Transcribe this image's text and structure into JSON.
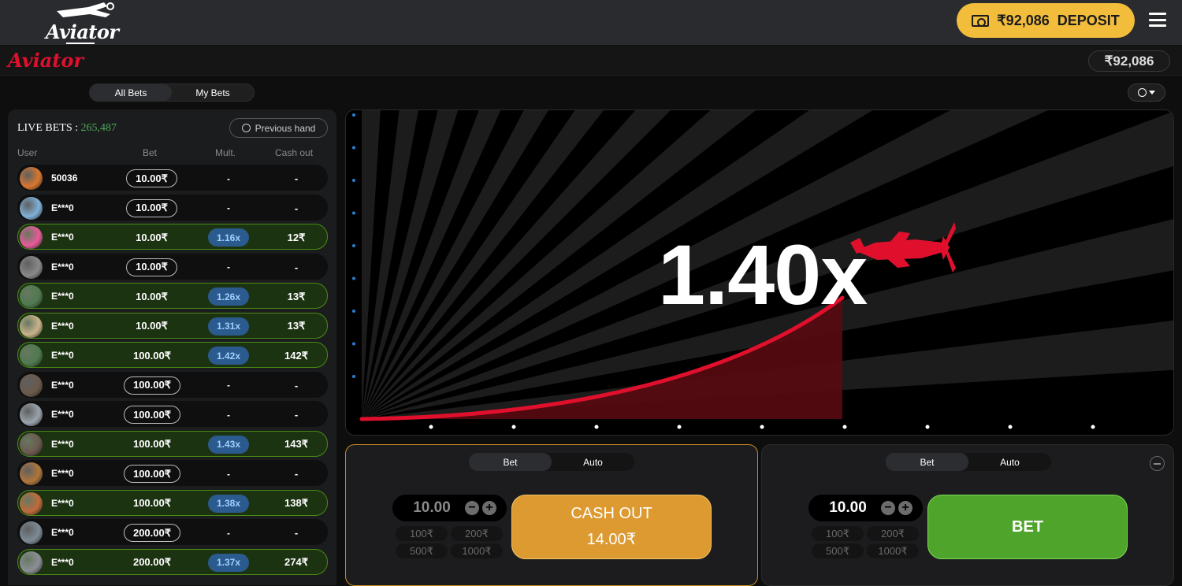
{
  "header": {
    "logo_text": "Aviator",
    "deposit": {
      "balance": "₹92,086",
      "label": "DEPOSIT"
    }
  },
  "subheader": {
    "game_logo": "Aviator",
    "balance": "₹92,086"
  },
  "bets_tabs": [
    {
      "label": "All Bets",
      "active": true
    },
    {
      "label": "My Bets",
      "active": false
    }
  ],
  "live_bets": {
    "title": "LIVE BETS",
    "separator": " : ",
    "count": "265,487",
    "previous_hand": "Previous hand",
    "columns": {
      "user": "User",
      "bet": "Bet",
      "mult": "Mult.",
      "cashout": "Cash out"
    },
    "rows": [
      {
        "user": "50036",
        "bet": "10.00₹",
        "mult": "-",
        "cashout": "-",
        "win": false,
        "avatar_color": "#d9772e"
      },
      {
        "user": "E***0",
        "bet": "10.00₹",
        "mult": "-",
        "cashout": "-",
        "win": false,
        "avatar_color": "#7fb1d8"
      },
      {
        "user": "E***0",
        "bet": "10.00₹",
        "mult": "1.16x",
        "cashout": "12₹",
        "win": true,
        "avatar_color": "#e85a9a"
      },
      {
        "user": "E***0",
        "bet": "10.00₹",
        "mult": "-",
        "cashout": "-",
        "win": false,
        "avatar_color": "#8a8a8a"
      },
      {
        "user": "E***0",
        "bet": "10.00₹",
        "mult": "1.26x",
        "cashout": "13₹",
        "win": true,
        "avatar_color": "#4f7a4f"
      },
      {
        "user": "E***0",
        "bet": "10.00₹",
        "mult": "1.31x",
        "cashout": "13₹",
        "win": true,
        "avatar_color": "#c9b48a"
      },
      {
        "user": "E***0",
        "bet": "100.00₹",
        "mult": "1.42x",
        "cashout": "142₹",
        "win": true,
        "avatar_color": "#4f7a4f"
      },
      {
        "user": "E***0",
        "bet": "100.00₹",
        "mult": "-",
        "cashout": "-",
        "win": false,
        "avatar_color": "#6a5a4a"
      },
      {
        "user": "E***0",
        "bet": "100.00₹",
        "mult": "-",
        "cashout": "-",
        "win": false,
        "avatar_color": "#9aa3ad"
      },
      {
        "user": "E***0",
        "bet": "100.00₹",
        "mult": "1.43x",
        "cashout": "143₹",
        "win": true,
        "avatar_color": "#6b5a4f"
      },
      {
        "user": "E***0",
        "bet": "100.00₹",
        "mult": "-",
        "cashout": "-",
        "win": false,
        "avatar_color": "#b0763a"
      },
      {
        "user": "E***0",
        "bet": "100.00₹",
        "mult": "1.38x",
        "cashout": "138₹",
        "win": true,
        "avatar_color": "#c06a3a"
      },
      {
        "user": "E***0",
        "bet": "200.00₹",
        "mult": "-",
        "cashout": "-",
        "win": false,
        "avatar_color": "#7d8b95"
      },
      {
        "user": "E***0",
        "bet": "200.00₹",
        "mult": "1.37x",
        "cashout": "274₹",
        "win": true,
        "avatar_color": "#8a8f96"
      }
    ]
  },
  "game": {
    "multiplier": "1.40x",
    "colors": {
      "curve": "#e0102d",
      "fill": "#5a0a12",
      "plane": "#e0102d"
    }
  },
  "bet_panels": [
    {
      "active": true,
      "tabs": [
        {
          "label": "Bet",
          "active": true
        },
        {
          "label": "Auto",
          "active": false
        }
      ],
      "stake": "10.00",
      "stake_dim": true,
      "quick": [
        "100₹",
        "200₹",
        "500₹",
        "1000₹"
      ],
      "button": {
        "kind": "cashout",
        "line1": "CASH OUT",
        "line2": "14.00₹"
      }
    },
    {
      "active": false,
      "tabs": [
        {
          "label": "Bet",
          "active": true
        },
        {
          "label": "Auto",
          "active": false
        }
      ],
      "stake": "10.00",
      "stake_dim": false,
      "quick": [
        "100₹",
        "200₹",
        "500₹",
        "1000₹"
      ],
      "button": {
        "kind": "bet",
        "line1": "BET",
        "line2": ""
      }
    }
  ]
}
